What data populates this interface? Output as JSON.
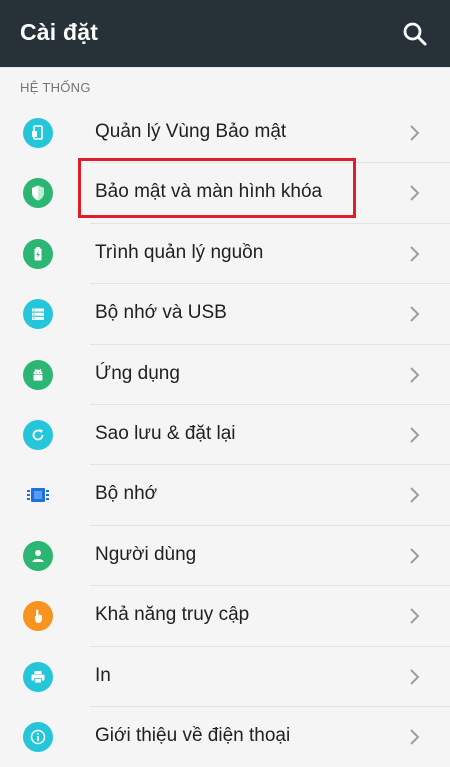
{
  "app_bar": {
    "title": "Cài đặt",
    "search_icon": "search-icon",
    "background": "#263238"
  },
  "section": {
    "header": "HỆ THỐNG"
  },
  "items": [
    {
      "label": "Quản lý Vùng Bảo mật",
      "icon": "secure-folder-icon",
      "color": "#26c6da"
    },
    {
      "label": "Bảo mật và màn hình khóa",
      "icon": "shield-icon",
      "color": "#2bb673"
    },
    {
      "label": "Trình quản lý nguồn",
      "icon": "battery-icon",
      "color": "#2bb673"
    },
    {
      "label": "Bộ nhớ và USB",
      "icon": "storage-icon",
      "color": "#26c6da"
    },
    {
      "label": "Ứng dụng",
      "icon": "android-icon",
      "color": "#2bb673"
    },
    {
      "label": "Sao lưu & đặt lại",
      "icon": "backup-icon",
      "color": "#26c6da"
    },
    {
      "label": "Bộ nhớ",
      "icon": "memory-chip-icon",
      "color": "#1e6fe0"
    },
    {
      "label": "Người dùng",
      "icon": "user-icon",
      "color": "#2bb673"
    },
    {
      "label": "Khả năng truy cập",
      "icon": "accessibility-hand-icon",
      "color": "#f7931e"
    },
    {
      "label": "In",
      "icon": "printer-icon",
      "color": "#26c6da"
    },
    {
      "label": "Giới thiệu về điện thoại",
      "icon": "info-icon",
      "color": "#26c6da"
    }
  ],
  "highlight": {
    "target_item": "Bảo mật và màn hình khóa",
    "color": "#e01e2a"
  }
}
